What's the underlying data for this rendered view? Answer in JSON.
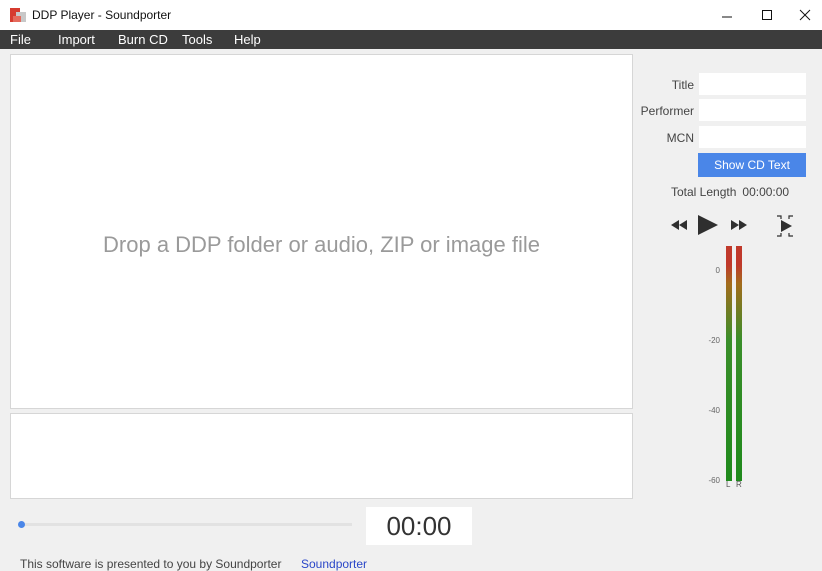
{
  "window": {
    "title": "DDP Player - Soundporter",
    "minimize_icon": "minimize-icon",
    "maximize_icon": "maximize-icon",
    "close_icon": "close-icon"
  },
  "menu": [
    "File",
    "Import",
    "Burn CD",
    "Tools",
    "Help"
  ],
  "drop_zone": {
    "message": "Drop a DDP folder or audio, ZIP or image file"
  },
  "cd_info": {
    "title_label": "Title",
    "title_value": "",
    "performer_label": "Performer",
    "performer_value": "",
    "mcn_label": "MCN",
    "mcn_value": "",
    "show_cd_text_button": "Show CD Text",
    "total_length_label": "Total Length",
    "total_length_value": "00:00:00"
  },
  "transport": {
    "icons": [
      "rewind-icon",
      "play-icon",
      "fast-forward-icon",
      "play-selection-icon"
    ]
  },
  "meter": {
    "scale": [
      "0",
      "-20",
      "-40",
      "-60"
    ],
    "channels": [
      "L",
      "R"
    ],
    "levels": {
      "L": 1.0,
      "R": 1.0
    }
  },
  "playback": {
    "time": "00:00",
    "progress": 0
  },
  "footer": {
    "text": "This software is presented to you by Soundporter",
    "link": "Soundporter"
  },
  "colors": {
    "accent": "#4a86e8",
    "menubar": "#3c3c3c",
    "link": "#2a46c8",
    "meter_peak": "#c0392b",
    "meter_level": "#1f8a1c"
  }
}
